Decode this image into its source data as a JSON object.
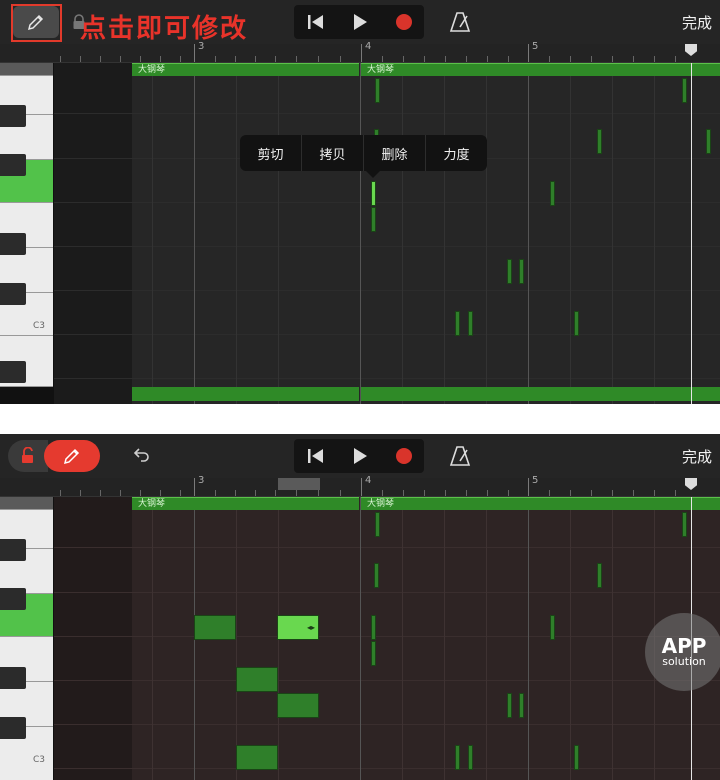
{
  "annotation": {
    "text": "点击即可修改"
  },
  "top": {
    "toolbar": {
      "done_label": "完成"
    },
    "ruler": {
      "numbers": [
        "3",
        "4",
        "5"
      ]
    },
    "regions": [
      "大钢琴",
      "大钢琴"
    ],
    "keyboard": {
      "c3_label": "C3"
    },
    "context_menu": {
      "items": [
        "剪切",
        "拷贝",
        "删除",
        "力度"
      ]
    }
  },
  "bottom": {
    "toolbar": {
      "done_label": "完成"
    },
    "ruler": {
      "numbers": [
        "3",
        "4",
        "5"
      ]
    },
    "regions": [
      "大钢琴",
      "大钢琴"
    ],
    "keyboard": {
      "c3_label": "C3"
    }
  },
  "watermark": {
    "line1": "APP",
    "line2": "solution"
  },
  "colors": {
    "note": "#2f7f2a",
    "note_selected": "#69d84f",
    "region": "#2f8a27",
    "record": "#d9342b",
    "annotation": "#e8332a",
    "pencil_active": "#e53a2f"
  },
  "icons": [
    "pencil-icon",
    "lock-icon",
    "unlock-icon",
    "undo-icon",
    "rewind-icon",
    "play-icon",
    "record-icon",
    "metronome-icon"
  ]
}
